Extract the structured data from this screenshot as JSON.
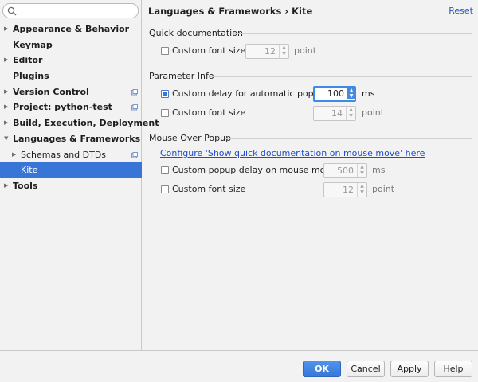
{
  "search": {
    "placeholder": "",
    "value": ""
  },
  "sidebar": {
    "items": [
      {
        "label": "Appearance & Behavior",
        "expandable": true
      },
      {
        "label": "Keymap",
        "expandable": false
      },
      {
        "label": "Editor",
        "expandable": true
      },
      {
        "label": "Plugins",
        "expandable": false
      },
      {
        "label": "Version Control",
        "expandable": true
      },
      {
        "label": "Project: python-test",
        "expandable": true
      },
      {
        "label": "Build, Execution, Deployment",
        "expandable": true
      },
      {
        "label": "Languages & Frameworks",
        "expandable": true,
        "expanded": true
      },
      {
        "label": "Schemas and DTDs",
        "expandable": true
      },
      {
        "label": "Kite",
        "selected": true
      },
      {
        "label": "Tools",
        "expandable": true
      }
    ]
  },
  "header": {
    "breadcrumb": "Languages & Frameworks › Kite",
    "reset": "Reset"
  },
  "quick_doc": {
    "title": "Quick documentation",
    "custom_font": {
      "label": "Custom font size:",
      "checked": false,
      "value": "12",
      "unit": "point"
    }
  },
  "param_info": {
    "title": "Parameter Info",
    "custom_delay": {
      "label": "Custom delay for automatic popup",
      "checked": true,
      "value": "100",
      "unit": "ms"
    },
    "custom_font": {
      "label": "Custom font size",
      "checked": false,
      "value": "14",
      "unit": "point"
    }
  },
  "mouse_over": {
    "title": "Mouse Over Popup",
    "link": "Configure 'Show quick documentation on mouse move' here",
    "custom_delay": {
      "label": "Custom popup delay on mouse move",
      "checked": false,
      "value": "500",
      "unit": "ms"
    },
    "custom_font": {
      "label": "Custom font size",
      "checked": false,
      "value": "12",
      "unit": "point"
    }
  },
  "footer": {
    "ok": "OK",
    "cancel": "Cancel",
    "apply": "Apply",
    "help": "Help"
  },
  "colors": {
    "accent": "#3875d7",
    "link": "#1b4fcf",
    "selected_bg": "#3875d7"
  }
}
